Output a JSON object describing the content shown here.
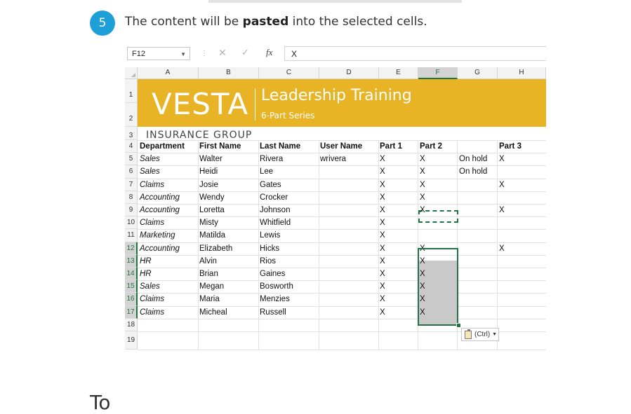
{
  "step": {
    "number": "5",
    "text_before": "The content will be ",
    "text_bold": "pasted",
    "text_after": " into the selected cells."
  },
  "excel": {
    "name_box": "F12",
    "formula_value": "X",
    "col_headers": [
      "A",
      "B",
      "C",
      "D",
      "E",
      "F",
      "G",
      "H"
    ],
    "row_headers": [
      "1",
      "2",
      "3",
      "4",
      "5",
      "6",
      "7",
      "8",
      "9",
      "10",
      "11",
      "12",
      "13",
      "14",
      "15",
      "16",
      "17",
      "18",
      "19"
    ],
    "banner": {
      "logo": "VESTA",
      "title": "Leadership Training",
      "subtitle": "6-Part Series",
      "tagline": "INSURANCE GROUP"
    },
    "headers": [
      "Department",
      "First Name",
      "Last Name",
      "User Name",
      "Part 1",
      "Part 2",
      "",
      "Part 3"
    ],
    "rows": [
      [
        "Sales",
        "Walter",
        "Rivera",
        "wrivera",
        "X",
        "X",
        "On hold",
        "X"
      ],
      [
        "Sales",
        "Heidi",
        "Lee",
        "",
        "X",
        "X",
        "On hold",
        ""
      ],
      [
        "Claims",
        "Josie",
        "Gates",
        "",
        "X",
        "X",
        "",
        "X"
      ],
      [
        "Accounting",
        "Wendy",
        "Crocker",
        "",
        "X",
        "X",
        "",
        ""
      ],
      [
        "Accounting",
        "Loretta",
        "Johnson",
        "",
        "X",
        "X",
        "",
        "X"
      ],
      [
        "Claims",
        "Misty",
        "Whitfield",
        "",
        "X",
        "",
        "",
        ""
      ],
      [
        "Marketing",
        "Matilda",
        "Lewis",
        "",
        "X",
        "",
        "",
        ""
      ],
      [
        "Accounting",
        "Elizabeth",
        "Hicks",
        "",
        "X",
        "X",
        "",
        "X"
      ],
      [
        "HR",
        "Alvin",
        "Rios",
        "",
        "X",
        "X",
        "",
        ""
      ],
      [
        "HR",
        "Brian",
        "Gaines",
        "",
        "X",
        "X",
        "",
        ""
      ],
      [
        "Sales",
        "Megan",
        "Bosworth",
        "",
        "X",
        "X",
        "",
        ""
      ],
      [
        "Claims",
        "Maria",
        "Menzies",
        "",
        "X",
        "X",
        "",
        ""
      ],
      [
        "Claims",
        "Micheal",
        "Russell",
        "",
        "X",
        "X",
        "",
        ""
      ]
    ],
    "paste_options_label": "(Ctrl)",
    "colors": {
      "banner": "#e8b425",
      "selection": "#217346",
      "badge": "#1e9fd8"
    }
  },
  "next_heading": "To"
}
